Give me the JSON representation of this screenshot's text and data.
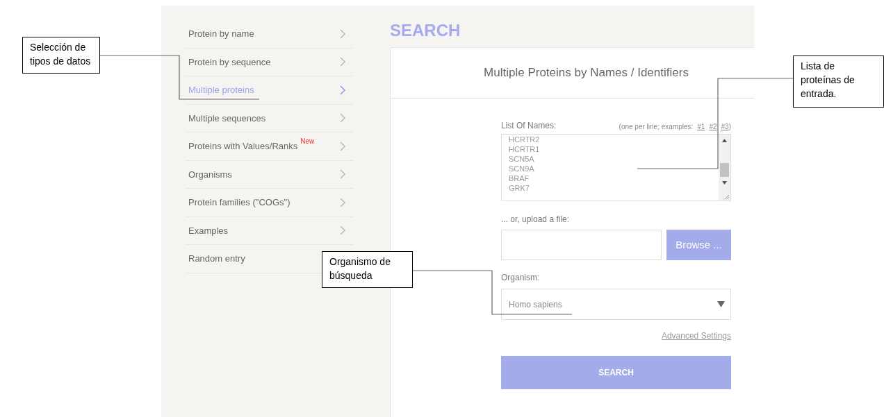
{
  "sidebar": {
    "items": [
      {
        "label": "Protein by name",
        "selected": false,
        "chevron": true
      },
      {
        "label": "Protein by sequence",
        "selected": false,
        "chevron": true
      },
      {
        "label": "Multiple proteins",
        "selected": true,
        "chevron": true
      },
      {
        "label": "Multiple sequences",
        "selected": false,
        "chevron": true
      },
      {
        "label": "Proteins with Values/Ranks",
        "badge": "New",
        "selected": false,
        "chevron": true
      },
      {
        "label": "Organisms",
        "selected": false,
        "chevron": true
      },
      {
        "label": "Protein families (\"COGs\")",
        "selected": false,
        "chevron": true
      },
      {
        "label": "Examples",
        "selected": false,
        "chevron": true
      },
      {
        "label": "Random entry",
        "selected": false
      }
    ]
  },
  "heading": "SEARCH",
  "panel": {
    "title": "Multiple Proteins by Names / Identifiers",
    "list_label": "List Of Names:",
    "hint_prefix": "(one per line; examples:",
    "example_links": [
      "#1",
      "#2",
      "#3"
    ],
    "hint_suffix": ")",
    "list_lines": [
      "HCRTR2",
      "HCRTR1",
      "SCN5A",
      "SCN9A",
      "BRAF",
      "GRK7"
    ],
    "upload_label": "... or, upload a file:",
    "browse_button": "Browse ...",
    "organism_label": "Organism:",
    "organism_value": "Homo sapiens",
    "advanced_link": "Advanced Settings",
    "search_button": "SEARCH"
  },
  "annotations": [
    "Selección de tipos de datos",
    "Organismo de búsqueda",
    "Lista de proteínas de entrada."
  ]
}
